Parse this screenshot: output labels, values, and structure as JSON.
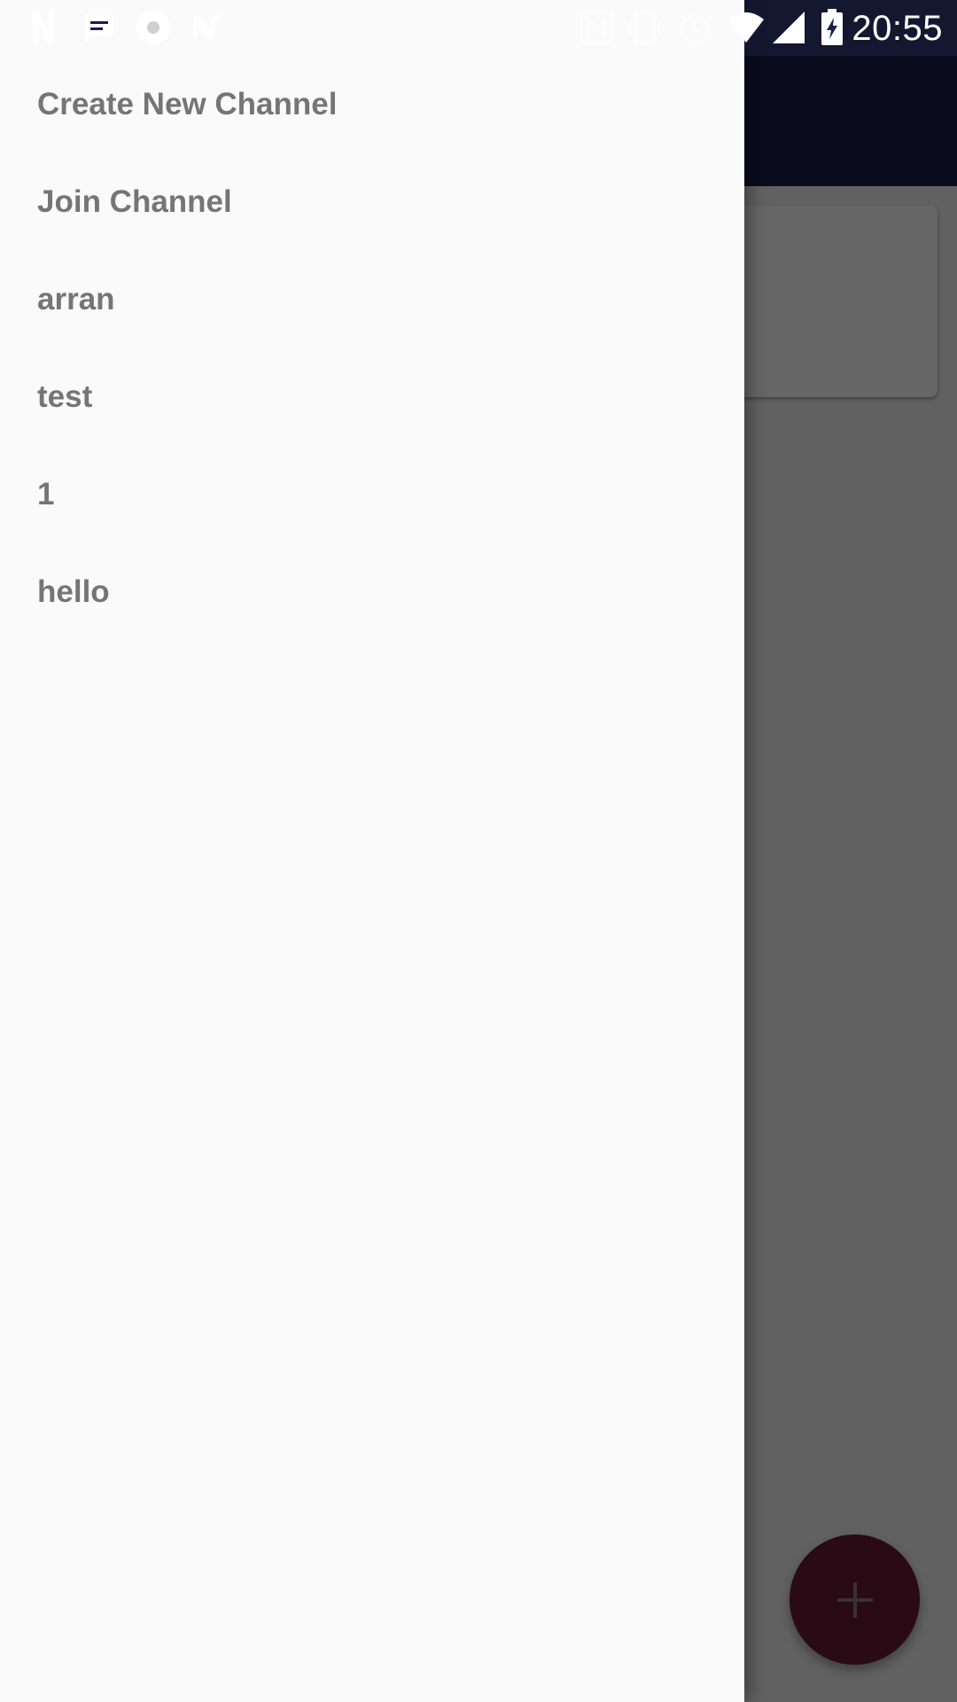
{
  "status_bar": {
    "time": "20:55",
    "left_icons": [
      "notification-n-icon",
      "message-icon",
      "app-icon",
      "missed-call-icon"
    ],
    "right_icons": [
      "nfc-icon",
      "vibrate-icon",
      "alarm-icon",
      "wifi-icon",
      "signal-icon",
      "battery-charging-icon"
    ]
  },
  "drawer": {
    "items": [
      {
        "label": "Create New Channel"
      },
      {
        "label": "Join Channel"
      },
      {
        "label": "arran"
      },
      {
        "label": "test"
      },
      {
        "label": "1"
      },
      {
        "label": "hello"
      }
    ]
  },
  "fab": {
    "icon": "add-icon"
  },
  "colors": {
    "toolbar": "#1a1f4b",
    "drawer_bg": "#fafafa",
    "item_text": "#757575",
    "fab": "#661a35"
  }
}
